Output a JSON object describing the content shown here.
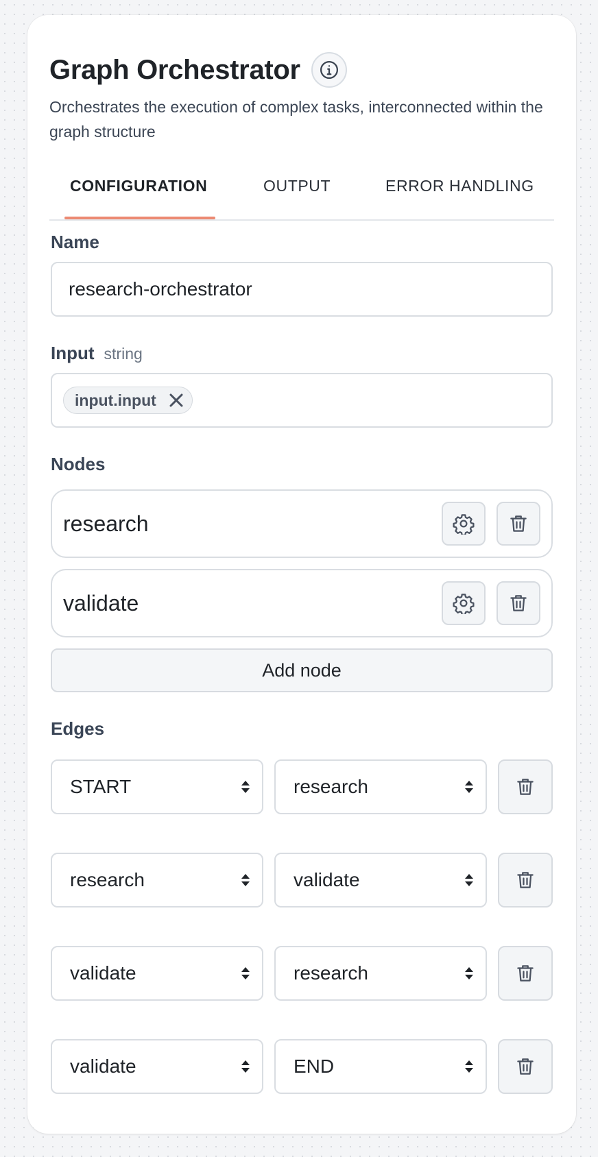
{
  "header": {
    "title": "Graph Orchestrator",
    "info_icon": "info-icon",
    "description": "Orchestrates the execution of complex tasks, interconnected within the graph structure"
  },
  "tabs": [
    {
      "label": "CONFIGURATION",
      "active": true
    },
    {
      "label": "OUTPUT",
      "active": false
    },
    {
      "label": "ERROR HANDLING",
      "active": false
    }
  ],
  "name_field": {
    "label": "Name",
    "value": "research-orchestrator"
  },
  "input_field": {
    "label": "Input",
    "type_hint": "string",
    "chips": [
      {
        "label": "input.input",
        "remove_icon": "close-icon"
      }
    ]
  },
  "nodes": {
    "label": "Nodes",
    "items": [
      {
        "name": "research",
        "settings_icon": "gear-icon",
        "delete_icon": "trash-icon"
      },
      {
        "name": "validate",
        "settings_icon": "gear-icon",
        "delete_icon": "trash-icon"
      }
    ],
    "add_label": "Add node"
  },
  "edges": {
    "label": "Edges",
    "items": [
      {
        "from": "START",
        "to": "research",
        "delete_icon": "trash-icon"
      },
      {
        "from": "research",
        "to": "validate",
        "delete_icon": "trash-icon"
      },
      {
        "from": "validate",
        "to": "research",
        "delete_icon": "trash-icon"
      },
      {
        "from": "validate",
        "to": "END",
        "delete_icon": "trash-icon"
      }
    ]
  },
  "colors": {
    "accent": "#ec8a72",
    "text": "#1f2328",
    "border": "#d9dde2"
  }
}
